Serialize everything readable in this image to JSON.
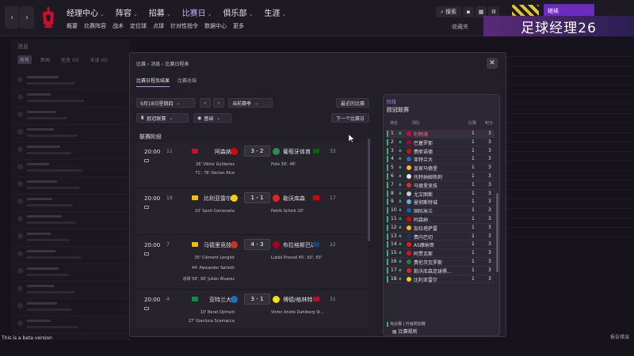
{
  "topbar": {
    "menu": [
      "经理中心",
      "阵容",
      "招募",
      "比赛日",
      "俱乐部",
      "生涯"
    ],
    "active_menu": "比赛日",
    "submenu": [
      "概要",
      "比赛阵容",
      "战术",
      "定位球",
      "点球",
      "针对性指令",
      "数据中心",
      "更多"
    ],
    "search_label": "搜索",
    "continue_label": "继续",
    "stream_banner": "足球经理26",
    "collect_label": "收藏夹"
  },
  "background": {
    "title": "消息",
    "tabs": [
      "所有",
      "新闻",
      "任务 (0)",
      "未读 (0)"
    ]
  },
  "modal": {
    "breadcrumb": "比赛 › 消息 › 比赛日程表",
    "tabs": [
      "比赛日程及结果",
      "比赛总结"
    ],
    "active_tab": "比赛日程及结果",
    "date_select": "9月18日星期四",
    "season_select": "当前赛季",
    "recent_btn": "最近的比赛",
    "comp_select": "欧冠联赛",
    "view_select": "基础",
    "next_btn": "下一个比赛日",
    "section_title": "联赛阶段",
    "fixtures": [
      {
        "time": "20:00",
        "home_num": "11",
        "home": "阿森纳",
        "score": "3 - 2",
        "away": "葡萄牙体育",
        "away_num": "33",
        "home_flag": "#c8102e",
        "away_flag": "#006600",
        "home_badge": "#db0007",
        "away_badge": "#2e8b57",
        "home_scorers": [
          "26' Viktor Gyökeres",
          "71', 78' Declan Rice"
        ],
        "away_scorers": [
          "Pote 39', 48'"
        ]
      },
      {
        "time": "20:00",
        "home_num": "18",
        "home": "比利亚雷尔",
        "score": "1 - 1",
        "away": "勒沃库森",
        "away_num": "17",
        "home_flag": "#f1bf00",
        "away_flag": "#dd0000",
        "home_badge": "#f5d000",
        "away_badge": "#e32221",
        "home_scorers": [
          "10' Santi Comesaña"
        ],
        "away_scorers": [
          "Patrik Schick 20'"
        ]
      },
      {
        "time": "20:00",
        "home_num": "7",
        "home": "马德里竞技",
        "score": "4 - 3",
        "away": "布拉格斯巴达",
        "away_num": "22",
        "home_flag": "#f1bf00",
        "away_flag": "#11457e",
        "home_badge": "#cb3524",
        "away_badge": "#a4001d",
        "home_scorers": [
          "35' Clément Lenglet",
          "44' Alexander Sørloth",
          "点球 58', 90' Julián Álvarez"
        ],
        "away_scorers": [
          "Lukáš Provod 45', 60', 63'"
        ]
      },
      {
        "time": "20:00",
        "home_num": "4",
        "home": "亚特兰大",
        "score": "3 - 1",
        "away": "博德/格林特",
        "away_num": "31",
        "home_flag": "#009246",
        "away_flag": "#ba0c2f",
        "home_badge": "#1e71b8",
        "away_badge": "#f5e300",
        "home_scorers": [
          "10' Berat Djimsiti",
          "27' Gianluca Scamacca"
        ],
        "away_scorers": [
          "Victor André Dahlberg St..."
        ]
      }
    ]
  },
  "standings": {
    "kicker": "阶段",
    "title": "欧冠联赛",
    "headers": {
      "pos": "排名",
      "team": "球队",
      "played": "比赛",
      "points": "积分"
    },
    "rows": [
      {
        "pos": "1",
        "team": "利物浦",
        "p": "1",
        "pts": "3",
        "badge": "#c8102e",
        "hl": true
      },
      {
        "pos": "2",
        "team": "巴塞罗那",
        "p": "1",
        "pts": "3",
        "badge": "#a50044"
      },
      {
        "pos": "3",
        "team": "费耶诺德",
        "p": "1",
        "pts": "3",
        "badge": "#d40f14"
      },
      {
        "pos": "4",
        "team": "亚特兰大",
        "p": "1",
        "pts": "3",
        "badge": "#1e71b8"
      },
      {
        "pos": "5",
        "team": "皇家马德里",
        "p": "1",
        "pts": "3",
        "badge": "#febe10"
      },
      {
        "pos": "6",
        "team": "托特纳姆热刺",
        "p": "1",
        "pts": "3",
        "badge": "#e8e8e8"
      },
      {
        "pos": "7",
        "team": "马德里竞技",
        "p": "1",
        "pts": "3",
        "badge": "#cb3524"
      },
      {
        "pos": "8",
        "team": "尤文图斯",
        "p": "1",
        "pts": "3",
        "badge": "#cccccc"
      },
      {
        "pos": "9",
        "team": "曼彻斯特城",
        "p": "1",
        "pts": "3",
        "badge": "#6cabdd"
      },
      {
        "pos": "10",
        "team": "国际米兰",
        "p": "1",
        "pts": "3",
        "badge": "#0068a8"
      },
      {
        "pos": "11",
        "team": "阿森纳",
        "p": "1",
        "pts": "3",
        "badge": "#db0007"
      },
      {
        "pos": "12",
        "team": "加拉塔萨雷",
        "p": "1",
        "pts": "3",
        "badge": "#fdb912"
      },
      {
        "pos": "13",
        "team": "费内巴切",
        "p": "1",
        "pts": "3",
        "badge": "#163962"
      },
      {
        "pos": "14",
        "team": "AS摩纳哥",
        "p": "1",
        "pts": "3",
        "badge": "#e51b22"
      },
      {
        "pos": "15",
        "team": "阿贾克斯",
        "p": "1",
        "pts": "3",
        "badge": "#d2122e"
      },
      {
        "pos": "16",
        "team": "费伦茨瓦罗斯",
        "p": "1",
        "pts": "3",
        "badge": "#118a3c"
      },
      {
        "pos": "17",
        "team": "勒沃库森足球俱...",
        "p": "1",
        "pts": "3",
        "badge": "#e32221"
      },
      {
        "pos": "18",
        "team": "比利亚雷尔",
        "p": "1",
        "pts": "3",
        "badge": "#f5d000"
      }
    ],
    "legend": "淘汰赛  |  升级附加赛",
    "rules_label": "比赛规则"
  },
  "footer": {
    "beta": "This is a beta version",
    "corner_tag": "报告错误"
  }
}
